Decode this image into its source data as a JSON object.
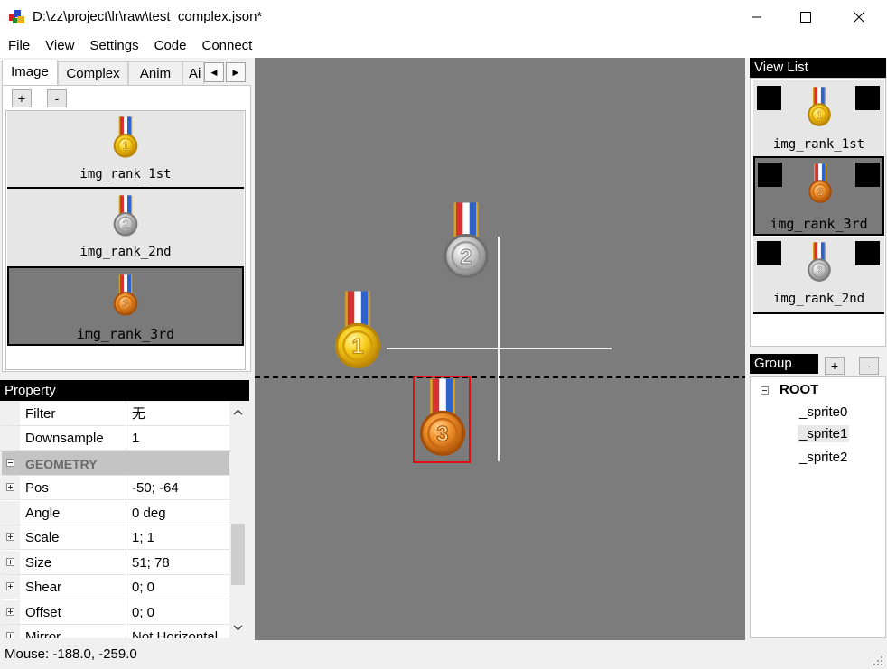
{
  "window": {
    "title": "D:\\zz\\project\\lr\\raw\\test_complex.json*",
    "minimize": "—",
    "maximize": "☐",
    "close": "✕"
  },
  "menu": [
    "File",
    "View",
    "Settings",
    "Code",
    "Connect"
  ],
  "left_tabs": {
    "tabs": [
      "Image",
      "Complex",
      "Anim",
      "Ai"
    ],
    "active": "Image",
    "scroll_left": "◀",
    "scroll_right": "▶"
  },
  "image_panel": {
    "add": "+",
    "remove": "-",
    "items": [
      {
        "label": "img_rank_1st",
        "medal": "1",
        "selected": false
      },
      {
        "label": "img_rank_2nd",
        "medal": "2",
        "selected": false
      },
      {
        "label": "img_rank_3rd",
        "medal": "3",
        "selected": true
      }
    ]
  },
  "property_panel": {
    "title": "Property",
    "rows": [
      {
        "name": "Filter",
        "value": "无"
      },
      {
        "name": "Downsample",
        "value": "1"
      },
      {
        "name": "GEOMETRY",
        "group": true
      },
      {
        "name": "Pos",
        "value": "-50; -64",
        "expandable": true
      },
      {
        "name": "Angle",
        "value": "0 deg"
      },
      {
        "name": "Scale",
        "value": "1; 1",
        "expandable": true
      },
      {
        "name": "Size",
        "value": "51; 78",
        "expandable": true
      },
      {
        "name": "Shear",
        "value": "0; 0",
        "expandable": true
      },
      {
        "name": "Offset",
        "value": "0; 0",
        "expandable": true
      },
      {
        "name": "Mirror",
        "value": "Not Horizontal",
        "expandable": true
      }
    ]
  },
  "status": {
    "mouse": "Mouse: -188.0, -259.0"
  },
  "view_list": {
    "title": "View List",
    "items": [
      {
        "label": "img_rank_1st",
        "medal": "1",
        "selected": false
      },
      {
        "label": "img_rank_3rd",
        "medal": "3",
        "selected": true
      },
      {
        "label": "img_rank_2nd",
        "medal": "2",
        "selected": false
      }
    ]
  },
  "group_panel": {
    "title": "Group",
    "add": "+",
    "remove": "-",
    "root": "ROOT",
    "children": [
      "_sprite0",
      "_sprite1",
      "_sprite2"
    ],
    "selected": "_sprite1"
  },
  "medal_colors": {
    "gold": "#f2c316",
    "silver": "#c0c0c0",
    "bronze": "#e8841e"
  }
}
